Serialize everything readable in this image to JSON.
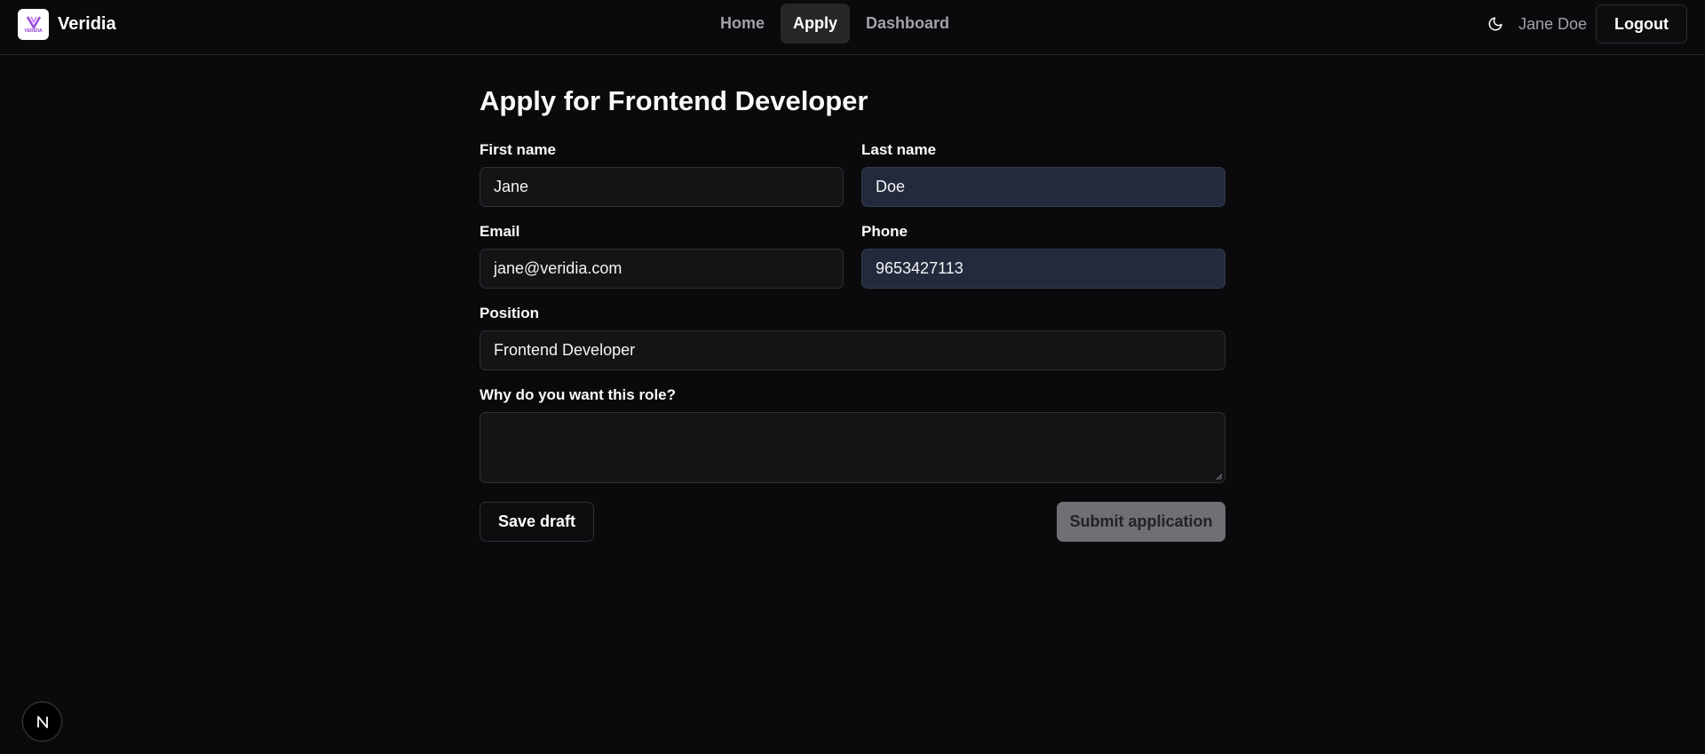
{
  "header": {
    "brand_name": "Veridia",
    "logo_text": "VERIDIA",
    "logo_icon": "veridia-v-logo",
    "nav": [
      {
        "label": "Home",
        "active": false
      },
      {
        "label": "Apply",
        "active": true
      },
      {
        "label": "Dashboard",
        "active": false
      }
    ],
    "theme_icon": "moon-icon",
    "user_name": "Jane Doe",
    "logout_label": "Logout"
  },
  "form": {
    "title": "Apply for Frontend Developer",
    "first_name": {
      "label": "First name",
      "value": "Jane"
    },
    "last_name": {
      "label": "Last name",
      "value": "Doe"
    },
    "email": {
      "label": "Email",
      "value": "jane@veridia.com"
    },
    "phone": {
      "label": "Phone",
      "value": "9653427113"
    },
    "position": {
      "label": "Position",
      "value": "Frontend Developer"
    },
    "motivation": {
      "label": "Why do you want this role?",
      "value": ""
    },
    "save_draft_label": "Save draft",
    "submit_label": "Submit application"
  },
  "dev_badge": {
    "icon": "nextjs-logo-icon",
    "letter": "N"
  },
  "colors": {
    "background": "#0a0a0c",
    "input_bg": "#141417",
    "autofill_bg": "#222a3c",
    "active_nav_bg": "#27272a",
    "submit_disabled_bg": "#6f6f74",
    "logo_accent": "#8b3fd1"
  }
}
